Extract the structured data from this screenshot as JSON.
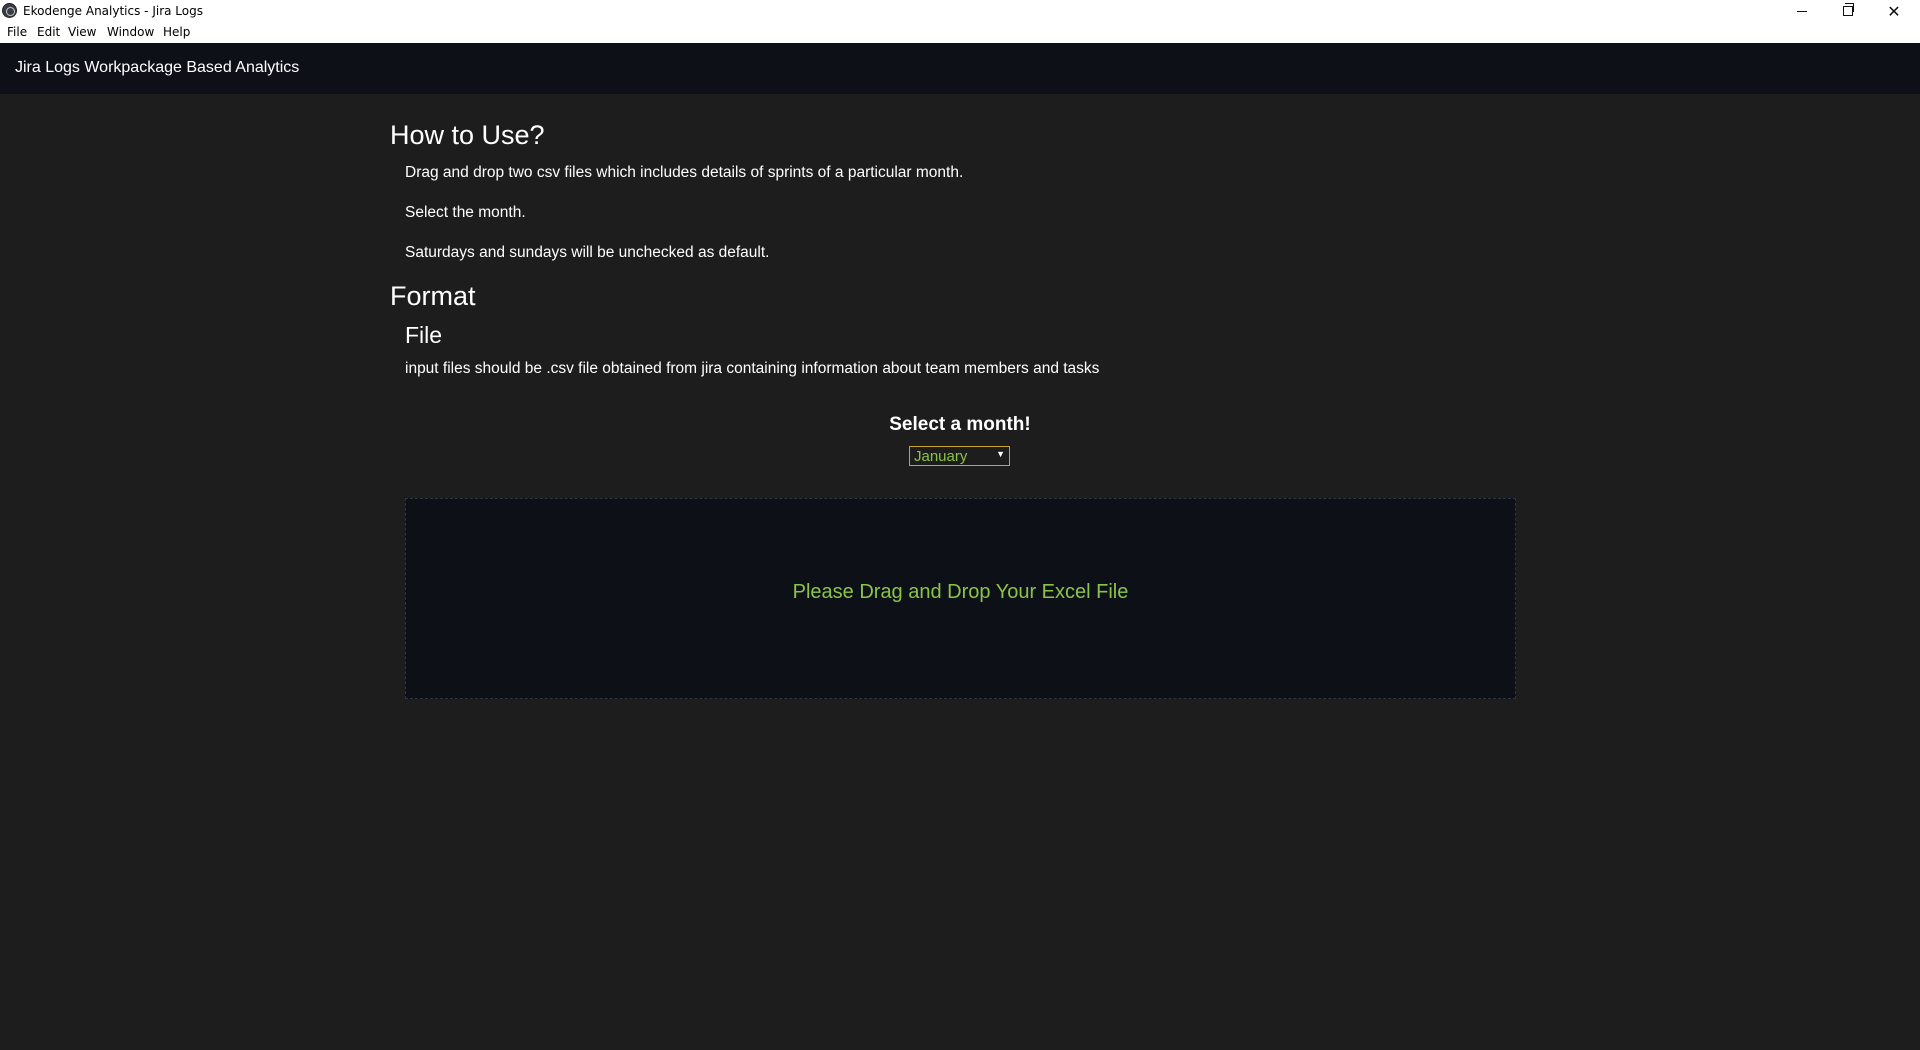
{
  "window": {
    "title": "Ekodenge Analytics - Jira Logs",
    "controls": {
      "minimize": "minimize-icon",
      "maximize": "restore-icon",
      "close": "close-icon",
      "close_glyph": "✕"
    }
  },
  "menu": {
    "file": "File",
    "edit": "Edit",
    "view": "View",
    "window": "Window",
    "help": "Help"
  },
  "appbar": {
    "title": "Jira Logs Workpackage Based Analytics"
  },
  "instructions": {
    "heading": "How to Use?",
    "step1": "Drag and drop two csv files which includes details of sprints of a particular month.",
    "step2": "Select the month.",
    "step3": "Saturdays and sundays will be unchecked as default."
  },
  "format": {
    "heading": "Format",
    "file_heading": "File",
    "file_desc": "input files should be .csv file obtained from jira containing information about team members and tasks"
  },
  "month_picker": {
    "label": "Select a month!",
    "selected": "January",
    "arrow": "▼"
  },
  "dropzone": {
    "text": "Please Drag and Drop Your Excel File"
  },
  "colors": {
    "background": "#1d1d1d",
    "appbar": "#0d1117",
    "accent_green": "#8bc34a",
    "select_border": "#c9a227"
  }
}
